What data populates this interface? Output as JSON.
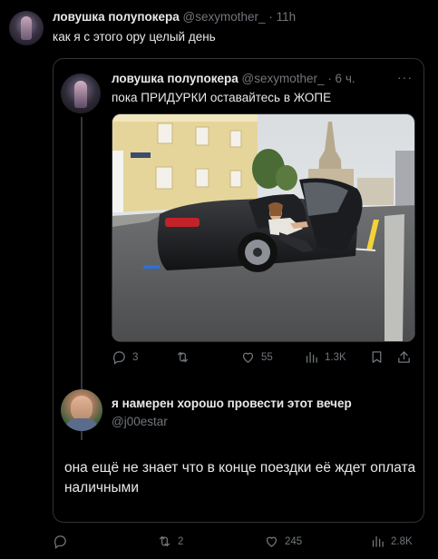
{
  "tweet": {
    "author_name": "ловушка полупокера",
    "author_handle": "@sexymother_",
    "separator": "·",
    "time": "11h",
    "text": "как я с этого ору целый день"
  },
  "quoted": {
    "author_name": "ловушка полупокера",
    "author_handle": "@sexymother_",
    "time": "· 6 ч.",
    "more": "···",
    "text": "пока ПРИДУРКИ оставайтесь в ЖОПЕ",
    "image_icon": "photo-car-woman",
    "actions": {
      "replies": "3",
      "retweets": "",
      "likes": "55",
      "views": "1.3K"
    },
    "reply": {
      "author_name": "я намерен хорошо провести этот вечер",
      "author_handle": "@j00estar",
      "text": "она ещё не знает что в конце поездки её ждет оплата наличными"
    }
  },
  "actions": {
    "replies": "",
    "retweets": "2",
    "likes": "245",
    "views": "2.8K"
  },
  "colors": {
    "background": "#000000",
    "text": "#e7e9ea",
    "muted": "#71767b",
    "border": "#2f3336"
  }
}
